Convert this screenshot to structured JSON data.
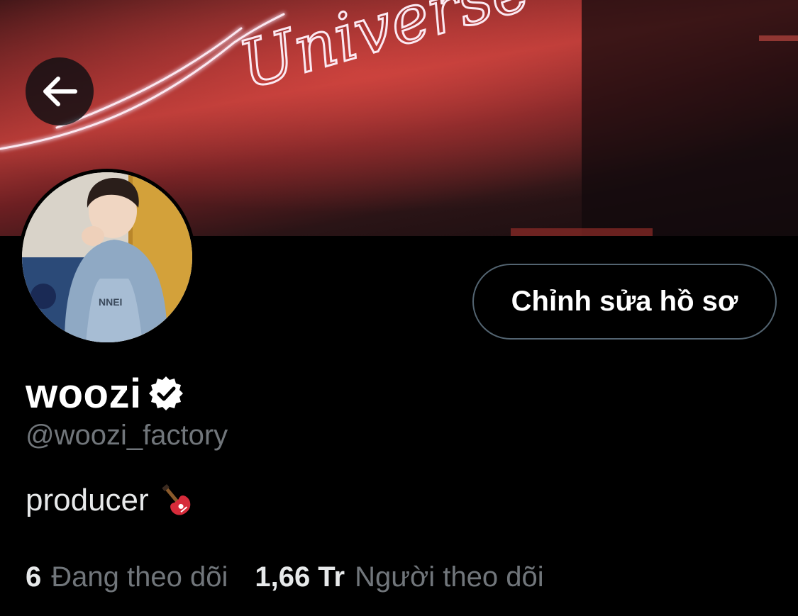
{
  "profile": {
    "display_name": "woozi",
    "handle": "@woozi_factory",
    "bio": "producer",
    "bio_emoji": "guitar-icon",
    "verified": true,
    "edit_button_label": "Chỉnh sửa hồ sơ",
    "banner_neon_text": "Universe"
  },
  "stats": {
    "following_count": "6",
    "following_label": "Đang theo dõi",
    "followers_count": "1,66 Tr",
    "followers_label": "Người theo dõi"
  },
  "icons": {
    "back": "arrow-left-icon",
    "verified": "verified-badge-icon"
  },
  "colors": {
    "background": "#000000",
    "text_primary": "#e7e9ea",
    "text_secondary": "#71767b",
    "button_border": "#536471"
  }
}
